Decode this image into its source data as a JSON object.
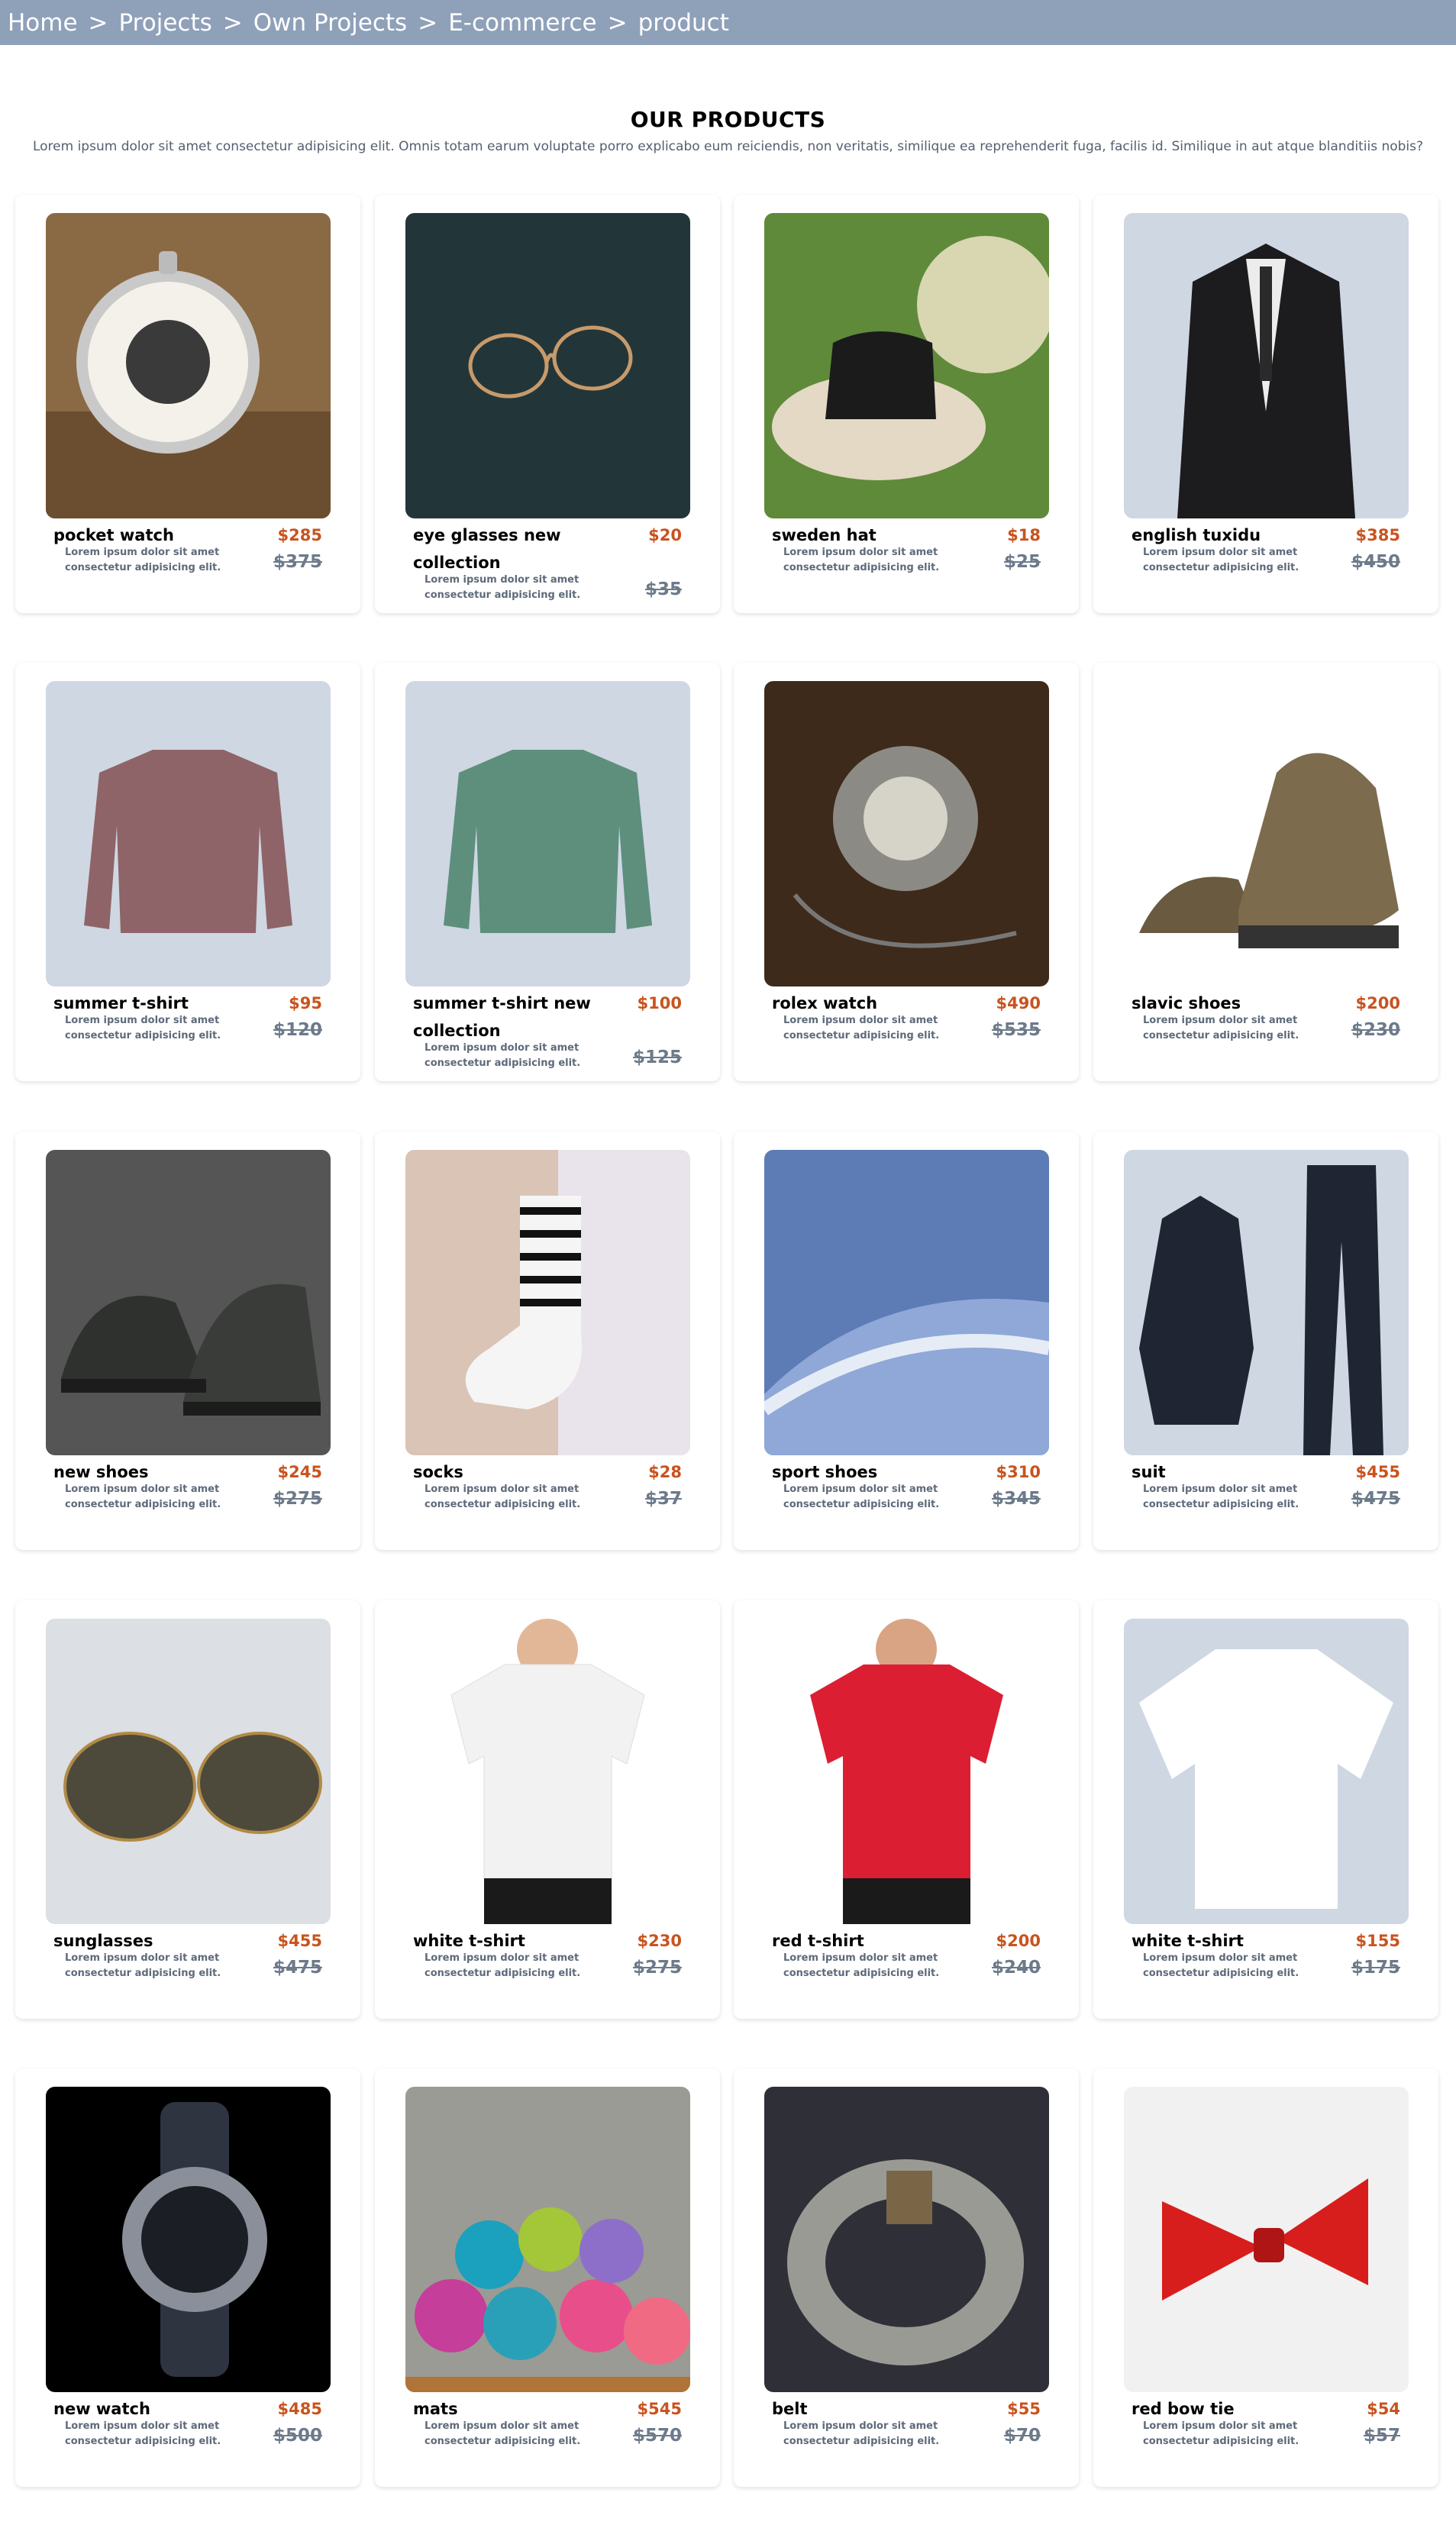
{
  "breadcrumb": {
    "items": [
      "Home",
      "Projects",
      "Own Projects",
      "E-commerce",
      "product"
    ],
    "separator": ">"
  },
  "heading": "OUR PRODUCTS",
  "subtitle": "Lorem ipsum dolor sit amet consectetur adipisicing elit. Omnis totam earum voluptate porro explicabo eum reiciendis, non veritatis, similique ea reprehenderit fuga, facilis id. Similique in aut atque blanditiis nobis?",
  "colors": {
    "topbar": "#8fa0b9",
    "price": "#c9531e",
    "old_price": "#6c7a8a"
  },
  "products": [
    {
      "name": "pocket watch",
      "price": "$285",
      "old_price": "$375",
      "desc": "Lorem ipsum dolor sit amet consectetur adipisicing elit.",
      "icon": "pocket-watch"
    },
    {
      "name": "eye glasses new collection",
      "price": "$20",
      "old_price": "$35",
      "desc": "Lorem ipsum dolor sit amet consectetur adipisicing elit.",
      "icon": "eye-glasses"
    },
    {
      "name": "sweden hat",
      "price": "$18",
      "old_price": "$25",
      "desc": "Lorem ipsum dolor sit amet consectetur adipisicing elit.",
      "icon": "hat"
    },
    {
      "name": "english tuxidu",
      "price": "$385",
      "old_price": "$450",
      "desc": "Lorem ipsum dolor sit amet consectetur adipisicing elit.",
      "icon": "tuxedo"
    },
    {
      "name": "summer t-shirt",
      "price": "$95",
      "old_price": "$120",
      "desc": "Lorem ipsum dolor sit amet consectetur adipisicing elit.",
      "icon": "sweater-mauve"
    },
    {
      "name": "summer t-shirt new collection",
      "price": "$100",
      "old_price": "$125",
      "desc": "Lorem ipsum dolor sit amet consectetur adipisicing elit.",
      "icon": "sweater-green"
    },
    {
      "name": "rolex watch",
      "price": "$490",
      "old_price": "$535",
      "desc": "Lorem ipsum dolor sit amet consectetur adipisicing elit.",
      "icon": "pocket-watch-ornate"
    },
    {
      "name": "slavic shoes",
      "price": "$200",
      "old_price": "$230",
      "desc": "Lorem ipsum dolor sit amet consectetur adipisicing elit.",
      "icon": "hiking-shoes"
    },
    {
      "name": "new shoes",
      "price": "$245",
      "old_price": "$275",
      "desc": "Lorem ipsum dolor sit amet consectetur adipisicing elit.",
      "icon": "sneakers"
    },
    {
      "name": "socks",
      "price": "$28",
      "old_price": "$37",
      "desc": "Lorem ipsum dolor sit amet consectetur adipisicing elit.",
      "icon": "sock"
    },
    {
      "name": "sport shoes",
      "price": "$310",
      "old_price": "$345",
      "desc": "Lorem ipsum dolor sit amet consectetur adipisicing elit.",
      "icon": "sport-shoe"
    },
    {
      "name": "suit",
      "price": "$455",
      "old_price": "$475",
      "desc": "Lorem ipsum dolor sit amet consectetur adipisicing elit.",
      "icon": "suit"
    },
    {
      "name": "sunglasses",
      "price": "$455",
      "old_price": "$475",
      "desc": "Lorem ipsum dolor sit amet consectetur adipisicing elit.",
      "icon": "sunglasses"
    },
    {
      "name": "white t-shirt",
      "price": "$230",
      "old_price": "$275",
      "desc": "Lorem ipsum dolor sit amet consectetur adipisicing elit.",
      "icon": "tshirt-white-model"
    },
    {
      "name": "red t-shirt",
      "price": "$200",
      "old_price": "$240",
      "desc": "Lorem ipsum dolor sit amet consectetur adipisicing elit.",
      "icon": "tshirt-red"
    },
    {
      "name": "white t-shirt",
      "price": "$155",
      "old_price": "$175",
      "desc": "Lorem ipsum dolor sit amet consectetur adipisicing elit.",
      "icon": "tshirt-white"
    },
    {
      "name": "new watch",
      "price": "$485",
      "old_price": "$500",
      "desc": "Lorem ipsum dolor sit amet consectetur adipisicing elit.",
      "icon": "wrist-watch"
    },
    {
      "name": "mats",
      "price": "$545",
      "old_price": "$570",
      "desc": "Lorem ipsum dolor sit amet consectetur adipisicing elit.",
      "icon": "yoga-mats"
    },
    {
      "name": "belt",
      "price": "$55",
      "old_price": "$70",
      "desc": "Lorem ipsum dolor sit amet consectetur adipisicing elit.",
      "icon": "belt"
    },
    {
      "name": "red bow tie",
      "price": "$54",
      "old_price": "$57",
      "desc": "Lorem ipsum dolor sit amet consectetur adipisicing elit.",
      "icon": "bow-tie"
    }
  ]
}
